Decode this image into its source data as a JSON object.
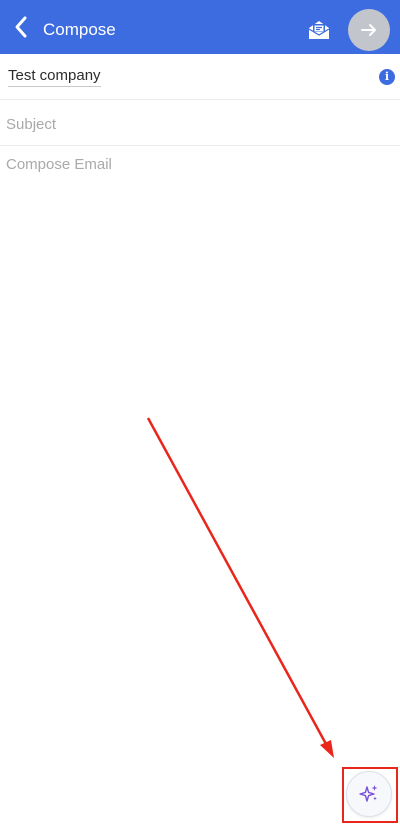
{
  "appbar": {
    "title": "Compose",
    "color": "#3d6be0",
    "icons": {
      "back": "chevron-left-icon",
      "template": "envelope-open-icon",
      "send": "arrow-right-icon"
    }
  },
  "recipients": {
    "to": "Test company",
    "info_icon": "info-icon"
  },
  "subject": {
    "value": "",
    "placeholder": "Subject"
  },
  "body": {
    "value": "",
    "placeholder": "Compose Email"
  },
  "ai_assist": {
    "icon": "sparkles-icon",
    "accent": "#7a4fd8"
  },
  "annotation": {
    "color": "#e8261b"
  }
}
